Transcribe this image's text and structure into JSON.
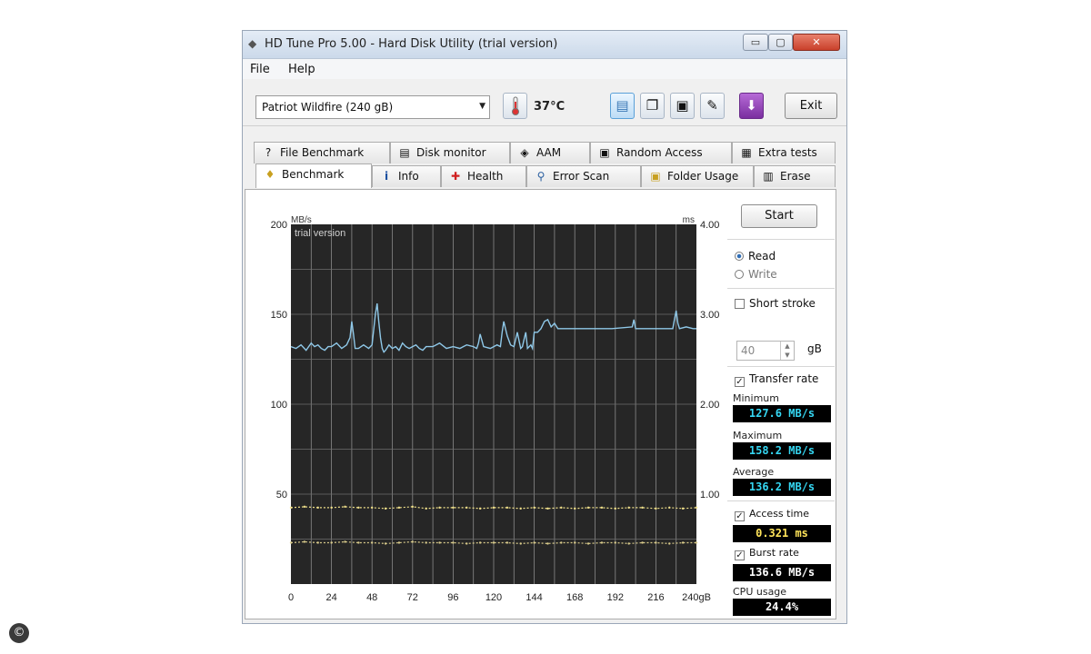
{
  "window": {
    "title": "HD Tune Pro 5.00 - Hard Disk Utility (trial version)",
    "min_glyph": "▭",
    "max_glyph": "▢",
    "close_glyph": "✕"
  },
  "menu": {
    "file": "File",
    "help": "Help"
  },
  "toolbar": {
    "drive": "Patriot Wildfire (240 gB)",
    "temperature": "37°C",
    "exit": "Exit",
    "icons": [
      "thermometer-icon",
      "benchmark-icon",
      "copy-icon",
      "save-icon",
      "options-icon",
      "download-icon"
    ]
  },
  "tabs": {
    "row1": [
      {
        "label": "File Benchmark",
        "icon": "file-benchmark-icon",
        "glyph": "?"
      },
      {
        "label": "Disk monitor",
        "icon": "disk-monitor-icon",
        "glyph": "▤"
      },
      {
        "label": "AAM",
        "icon": "aam-icon",
        "glyph": "◈"
      },
      {
        "label": "Random Access",
        "icon": "random-access-icon",
        "glyph": "▣"
      },
      {
        "label": "Extra tests",
        "icon": "extra-tests-icon",
        "glyph": "▦"
      }
    ],
    "row2": [
      {
        "label": "Benchmark",
        "icon": "benchmark-tab-icon",
        "glyph": "♦"
      },
      {
        "label": "Info",
        "icon": "info-icon",
        "glyph": "i"
      },
      {
        "label": "Health",
        "icon": "health-icon",
        "glyph": "✚"
      },
      {
        "label": "Error Scan",
        "icon": "error-scan-icon",
        "glyph": "⚲"
      },
      {
        "label": "Folder Usage",
        "icon": "folder-usage-icon",
        "glyph": "▣"
      },
      {
        "label": "Erase",
        "icon": "erase-icon",
        "glyph": "▥"
      }
    ],
    "active": "Benchmark"
  },
  "controls": {
    "start": "Start",
    "read": "Read",
    "write": "Write",
    "mode": "read",
    "short_stroke": "Short stroke",
    "short_stroke_checked": false,
    "stroke_value": "40",
    "stroke_unit": "gB",
    "transfer_rate": "Transfer rate",
    "transfer_rate_checked": true,
    "access_time": "Access time",
    "access_time_checked": true,
    "burst_rate": "Burst rate",
    "burst_rate_checked": true
  },
  "stats": {
    "minimum_label": "Minimum",
    "minimum": "127.6 MB/s",
    "maximum_label": "Maximum",
    "maximum": "158.2 MB/s",
    "average_label": "Average",
    "average": "136.2 MB/s",
    "access_time": "0.321 ms",
    "burst_rate": "136.6 MB/s",
    "cpu_label": "CPU usage",
    "cpu": "24.4%"
  },
  "watermark": "©",
  "chart_data": {
    "type": "line",
    "overlay_text": "trial version",
    "left_axis_unit": "MB/s",
    "right_axis_unit": "ms",
    "x_ticks": [
      "0",
      "24",
      "48",
      "72",
      "96",
      "120",
      "144",
      "168",
      "192",
      "216",
      "240gB"
    ],
    "left_ticks": [
      "200",
      "150",
      "100",
      "50"
    ],
    "right_ticks": [
      "4.00",
      "3.00",
      "2.00",
      "1.00"
    ],
    "xlim": [
      0,
      240
    ],
    "ylim": [
      0,
      200
    ],
    "ylim_right": [
      0,
      4
    ],
    "grid": true,
    "series": [
      {
        "name": "Transfer rate",
        "color": "#8fc8e8",
        "axis": "left",
        "x": [
          0,
          3,
          6,
          9,
          12,
          14,
          16,
          18,
          20,
          22,
          24,
          27,
          30,
          33,
          35,
          36,
          37,
          38,
          40,
          43,
          46,
          48,
          50,
          51,
          52,
          53,
          54,
          55,
          56,
          58,
          60,
          62,
          64,
          66,
          68,
          70,
          72,
          74,
          76,
          78,
          80,
          84,
          88,
          92,
          96,
          100,
          104,
          108,
          110,
          111,
          112,
          114,
          118,
          122,
          124,
          125,
          126,
          128,
          130,
          132,
          134,
          136,
          137,
          138,
          139,
          140,
          142,
          143,
          144,
          146,
          148,
          150,
          152,
          154,
          156,
          158,
          160,
          170,
          180,
          190,
          202,
          203,
          204,
          206,
          210,
          220,
          226,
          227,
          228,
          229,
          230,
          234,
          238,
          240
        ],
        "y": [
          132,
          131,
          133,
          130,
          134,
          132,
          133,
          131,
          130,
          132,
          132,
          134,
          131,
          133,
          137,
          146,
          139,
          131,
          131,
          133,
          131,
          133,
          150,
          156,
          146,
          137,
          131,
          129,
          130,
          133,
          131,
          132,
          130,
          134,
          132,
          131,
          132,
          133,
          131,
          130,
          132,
          132,
          134,
          131,
          132,
          131,
          133,
          132,
          131,
          134,
          139,
          132,
          131,
          133,
          132,
          140,
          146,
          138,
          133,
          132,
          140,
          131,
          132,
          136,
          140,
          131,
          133,
          131,
          140,
          140,
          142,
          146,
          147,
          143,
          145,
          142,
          142,
          142,
          142,
          142,
          143,
          147,
          142,
          142,
          142,
          142,
          142,
          147,
          152,
          145,
          142,
          143,
          142,
          142
        ]
      },
      {
        "name": "Access time",
        "color": "#f0e08a",
        "axis": "right",
        "x": [
          0,
          8,
          16,
          24,
          32,
          40,
          48,
          56,
          64,
          72,
          80,
          88,
          96,
          104,
          112,
          120,
          128,
          136,
          144,
          152,
          160,
          168,
          176,
          184,
          192,
          200,
          208,
          216,
          224,
          232,
          240
        ],
        "y": [
          0.85,
          0.86,
          0.85,
          0.85,
          0.86,
          0.85,
          0.85,
          0.84,
          0.85,
          0.86,
          0.84,
          0.85,
          0.85,
          0.85,
          0.84,
          0.85,
          0.85,
          0.84,
          0.85,
          0.84,
          0.85,
          0.84,
          0.85,
          0.85,
          0.84,
          0.85,
          0.85,
          0.84,
          0.85,
          0.84,
          0.85
        ]
      },
      {
        "name": "Burst rate",
        "color": "#d7c98a",
        "axis": "right",
        "x": [
          0,
          8,
          16,
          24,
          32,
          40,
          48,
          56,
          64,
          72,
          80,
          88,
          96,
          104,
          112,
          120,
          128,
          136,
          144,
          152,
          160,
          168,
          176,
          184,
          192,
          200,
          208,
          216,
          224,
          232,
          240
        ],
        "y": [
          0.46,
          0.47,
          0.46,
          0.46,
          0.47,
          0.46,
          0.46,
          0.45,
          0.46,
          0.47,
          0.46,
          0.46,
          0.46,
          0.45,
          0.46,
          0.46,
          0.46,
          0.45,
          0.46,
          0.45,
          0.46,
          0.46,
          0.45,
          0.46,
          0.46,
          0.45,
          0.46,
          0.46,
          0.45,
          0.46,
          0.46
        ]
      }
    ]
  }
}
